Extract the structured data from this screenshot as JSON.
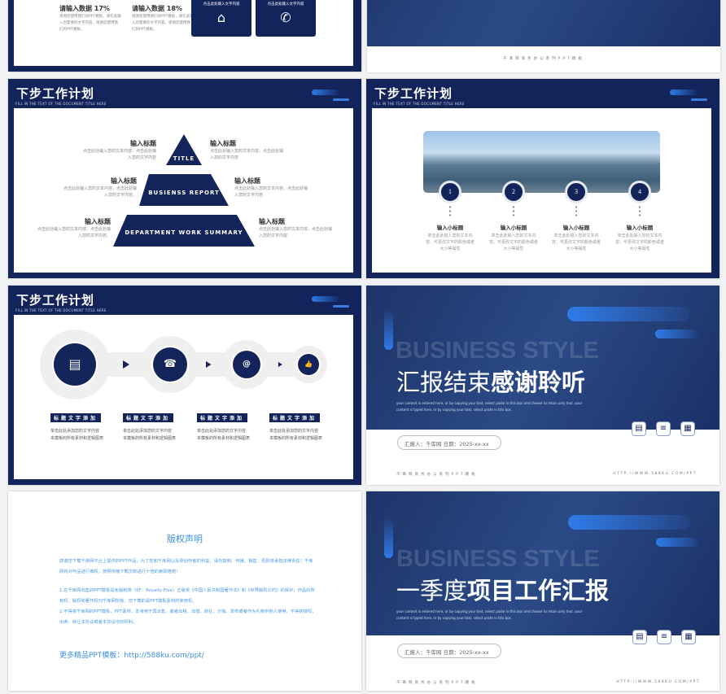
{
  "slide1": {
    "items": [
      {
        "title": "请输入数据 17%",
        "desc": "感谢您使用我们的PPT模板，请在此输入您需要的文字内容，感谢您使用我们的PPT模板。"
      },
      {
        "title": "请输入数据 18%",
        "desc": "感谢您使用我们的PPT模板，请在此输入您需要的文字内容，感谢您使用我们的PPT模板。"
      }
    ],
    "cards": [
      {
        "text": "点击此处输入文字内容",
        "icon": "home-icon",
        "glyph": "⌂"
      },
      {
        "text": "点击此处输入文字内容",
        "icon": "phone-icon",
        "glyph": "✆"
      }
    ]
  },
  "slide2": {
    "footer": "千库网商务办公系列PPT模板"
  },
  "header": {
    "title": "下步工作计划",
    "subtitle": "FILL IN THE TEXT OF THE DOCUMENT TITLE HERE"
  },
  "pyramid": {
    "levels": [
      "TITLE",
      "BUSIENSS REPORT",
      "DEPARTMENT WORK SUMMARY"
    ],
    "left": [
      {
        "title": "输入标题",
        "desc": "点击此处输入您的文本内容，点击此处输入您的文字内容"
      },
      {
        "title": "输入标题",
        "desc": "点击此处输入您的文本内容，点击此处输入您的文字内容。"
      },
      {
        "title": "输入标题",
        "desc": "点击此处输入您的文本内容，点击此处输入您的文字内容。"
      }
    ],
    "right": [
      {
        "title": "输入标题",
        "desc": "点击此处输入您的文本内容，点击此处输入您的文字内容"
      },
      {
        "title": "输入标题",
        "desc": "点击此处输入您的文本内容，点击此处输入您的文字内容"
      },
      {
        "title": "输入标题",
        "desc": "点击此处输入您的文本内容，点击此处输入您的文字内容"
      }
    ]
  },
  "steps": [
    {
      "num": "1",
      "title": "输入小标题",
      "desc": "单击此处输入您的文本内容，可更改文字的颜色或者大小等属性"
    },
    {
      "num": "2",
      "title": "输入小标题",
      "desc": "单击此处输入您的文本内容，可更改文字的颜色或者大小等属性"
    },
    {
      "num": "3",
      "title": "输入小标题",
      "desc": "单击此处输入您的文本内容，可更改文字的颜色或者大小等属性"
    },
    {
      "num": "4",
      "title": "输入小标题",
      "desc": "单击此处输入您的文本内容，可更改文字的颜色或者大小等属性"
    }
  ],
  "flow": [
    {
      "icon": "chat-icon",
      "glyph": "▤",
      "tag": "标题文字添加",
      "desc1": "单击此处添加您的文字内容",
      "desc2": "本模板的所有素材和逻辑图表"
    },
    {
      "icon": "telephone-icon",
      "glyph": "☎",
      "tag": "标题文字添加",
      "desc1": "单击此处添加您的文字内容",
      "desc2": "本模板的所有素材和逻辑图表"
    },
    {
      "icon": "email-icon",
      "glyph": "@",
      "tag": "标题文字添加",
      "desc1": "单击此处添加您的文字内容",
      "desc2": "本模板的所有素材和逻辑图表"
    },
    {
      "icon": "thumbs-up-icon",
      "glyph": "👍",
      "tag": "标题文字添加",
      "desc1": "单击此处添加您的文字内容",
      "desc2": "本模板的所有素材和逻辑图表"
    }
  ],
  "closing": {
    "bg_text": "BUSINESS STYLE",
    "title_light": "汇报结束",
    "title_bold": "感谢聆听",
    "body": "your content is entered here, or by copying your text, select paste in this box and choose to retain only text. your content is typed here, or by copying your text, select paste in this box.",
    "reporter": "汇报人：千库网   日期：2025-xx-xx",
    "footer_left": "千库网商务办公系列PPT模板",
    "footer_right": "HTTP://WWW.588KU.COM/PPT"
  },
  "copyright": {
    "title": "版权声明",
    "p1": "感谢您下载千库网平台上提供的PPT作品，为了您和千库网以及原创作者的利益，请勿复制、传播、销售，否则将承担法律责任！千库网将对作品进行维权，按照传播下载次数进行十倍的索取赔偿！",
    "p2": "1.在千库网出售的PPT模板是免版税类（RF：Royalty-Free）正版受《中国人民共和国著作法》和《世界版权公约》的保护，作品的所有权、版权和著作权归千库网所有，您下载的是PPT模板素材的使用权。",
    "p3": "2.不得将千库网的PPT模板、PPT素材，本身用于再出售，或者出租、出借、转让、分销、发布或者作为礼物供他人使用，不得转授权、出卖、转让本协议或者本协议中的权利。",
    "more": "更多精品PPT模板：http://588ku.com/ppt/"
  },
  "cover": {
    "bg_text": "BUSINESS STYLE",
    "title_light": "一季度",
    "title_bold": "项目工作汇报",
    "body": "your content is entered here, or by copying your text, select paste in this box and choose to retain only text. your content is typed here, or by copying your text, select paste in this box.",
    "reporter": "汇报人：千库网   日期：2025-xx-xx",
    "footer_left": "千库网商务办公系列PPT模板",
    "footer_right": "HTTP://WWW.588KU.COM/PPT"
  },
  "colors": {
    "navy": "#13245a",
    "accent": "#2f7ae8",
    "copyright_blue": "#3d8fe0"
  }
}
